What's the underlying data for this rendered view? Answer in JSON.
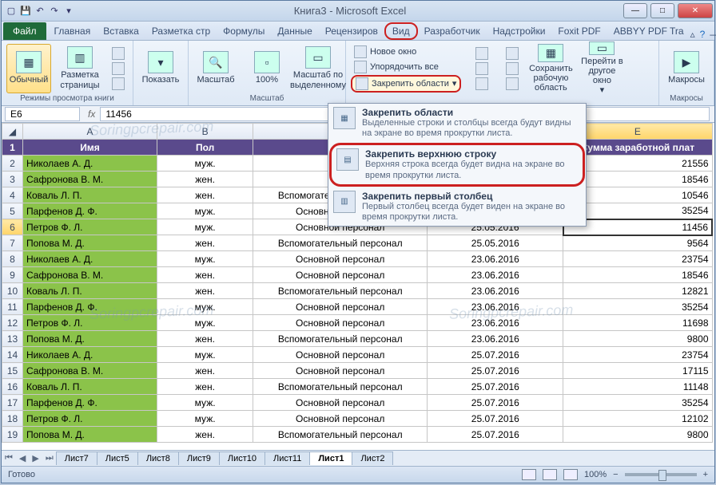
{
  "title": "Книга3 - Microsoft Excel",
  "tabs": {
    "file": "Файл",
    "items": [
      "Главная",
      "Вставка",
      "Разметка стр",
      "Формулы",
      "Данные",
      "Рецензиров",
      "Вид",
      "Разработчик",
      "Надстройки",
      "Foxit PDF",
      "ABBYY PDF Tra"
    ],
    "active": "Вид"
  },
  "ribbon": {
    "g1": {
      "label": "Режимы просмотра книги",
      "normal": "Обычный",
      "layout": "Разметка\nстраницы"
    },
    "g2": {
      "show": "Показать"
    },
    "g3": {
      "label": "Масштаб",
      "zoom": "Масштаб",
      "pct": "100%",
      "sel": "Масштаб по\nвыделенному"
    },
    "g4": {
      "newwin": "Новое окно",
      "arrange": "Упорядочить все",
      "freeze": "Закрепить области",
      "save": "Сохранить\nрабочую область",
      "goto": "Перейти в\nдругое окно"
    },
    "g5": {
      "label": "Макросы",
      "macros": "Макросы"
    }
  },
  "freeze_menu": [
    {
      "title": "Закрепить области",
      "desc": "Выделенные строки и столбцы всегда будут видны на экране во время прокрутки листа."
    },
    {
      "title": "Закрепить верхнюю строку",
      "desc": "Верхняя строка всегда будет видна на экране во время прокрутки листа."
    },
    {
      "title": "Закрепить первый столбец",
      "desc": "Первый столбец всегда будет виден на экране во время прокрутки листа."
    }
  ],
  "namebox": "E6",
  "fx": "11456",
  "cols": [
    "A",
    "B",
    "C",
    "D",
    "E"
  ],
  "headers": [
    "Имя",
    "Пол",
    "Ка",
    "",
    "Сумма заработной плат"
  ],
  "rows": [
    {
      "n": 2,
      "name": "Николаев А. Д.",
      "sex": "муж.",
      "cat": "О",
      "date": "",
      "sum": "21556"
    },
    {
      "n": 3,
      "name": "Сафронова В. М.",
      "sex": "жен.",
      "cat": "О",
      "date": "",
      "sum": "18546"
    },
    {
      "n": 4,
      "name": "Коваль Л. П.",
      "sex": "жен.",
      "cat": "Вспомогательный персонал",
      "date": "25.05.2016",
      "sum": "10546"
    },
    {
      "n": 5,
      "name": "Парфенов Д. Ф.",
      "sex": "муж.",
      "cat": "Основной персонал",
      "date": "25.05.2016",
      "sum": "35254"
    },
    {
      "n": 6,
      "name": "Петров Ф. Л.",
      "sex": "муж.",
      "cat": "Основной персонал",
      "date": "25.05.2016",
      "sum": "11456",
      "sel": true
    },
    {
      "n": 7,
      "name": "Попова М. Д.",
      "sex": "жен.",
      "cat": "Вспомогательный персонал",
      "date": "25.05.2016",
      "sum": "9564"
    },
    {
      "n": 8,
      "name": "Николаев А. Д.",
      "sex": "муж.",
      "cat": "Основной персонал",
      "date": "23.06.2016",
      "sum": "23754"
    },
    {
      "n": 9,
      "name": "Сафронова В. М.",
      "sex": "жен.",
      "cat": "Основной персонал",
      "date": "23.06.2016",
      "sum": "18546"
    },
    {
      "n": 10,
      "name": "Коваль Л. П.",
      "sex": "жен.",
      "cat": "Вспомогательный персонал",
      "date": "23.06.2016",
      "sum": "12821"
    },
    {
      "n": 11,
      "name": "Парфенов Д. Ф.",
      "sex": "муж.",
      "cat": "Основной персонал",
      "date": "23.06.2016",
      "sum": "35254"
    },
    {
      "n": 12,
      "name": "Петров Ф. Л.",
      "sex": "муж.",
      "cat": "Основной персонал",
      "date": "23.06.2016",
      "sum": "11698"
    },
    {
      "n": 13,
      "name": "Попова М. Д.",
      "sex": "жен.",
      "cat": "Вспомогательный персонал",
      "date": "23.06.2016",
      "sum": "9800"
    },
    {
      "n": 14,
      "name": "Николаев А. Д.",
      "sex": "муж.",
      "cat": "Основной персонал",
      "date": "25.07.2016",
      "sum": "23754"
    },
    {
      "n": 15,
      "name": "Сафронова В. М.",
      "sex": "жен.",
      "cat": "Основной персонал",
      "date": "25.07.2016",
      "sum": "17115"
    },
    {
      "n": 16,
      "name": "Коваль Л. П.",
      "sex": "жен.",
      "cat": "Вспомогательный персонал",
      "date": "25.07.2016",
      "sum": "11148"
    },
    {
      "n": 17,
      "name": "Парфенов Д. Ф.",
      "sex": "муж.",
      "cat": "Основной персонал",
      "date": "25.07.2016",
      "sum": "35254"
    },
    {
      "n": 18,
      "name": "Петров Ф. Л.",
      "sex": "муж.",
      "cat": "Основной персонал",
      "date": "25.07.2016",
      "sum": "12102"
    },
    {
      "n": 19,
      "name": "Попова М. Д.",
      "sex": "жен.",
      "cat": "Вспомогательный персонал",
      "date": "25.07.2016",
      "sum": "9800"
    }
  ],
  "sheets": [
    "Лист7",
    "Лист5",
    "Лист8",
    "Лист9",
    "Лист10",
    "Лист11",
    "Лист1",
    "Лист2"
  ],
  "active_sheet": "Лист1",
  "status": "Готово",
  "zoom": "100%"
}
